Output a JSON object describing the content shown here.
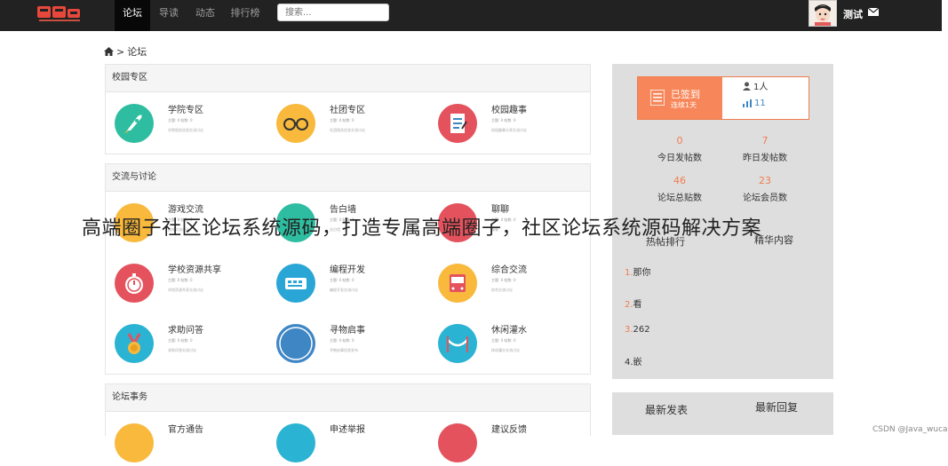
{
  "navbar": {
    "logo_icon": "site-logo-icon",
    "items": [
      {
        "label": "论坛",
        "active": true
      },
      {
        "label": "导读",
        "active": false
      },
      {
        "label": "动态",
        "active": false
      },
      {
        "label": "排行榜",
        "active": false
      }
    ],
    "search_placeholder": "搜索...",
    "username": "测试"
  },
  "breadcrumb": {
    "home_icon": "home-icon",
    "separator": ">",
    "current": "论坛"
  },
  "sections": [
    {
      "title": "校园专区",
      "forums": [
        {
          "name": "学院专区",
          "stats": "主题: 0  帖数: 0",
          "desc": "学院相关信息交流讨论",
          "color": "#2ebda0"
        },
        {
          "name": "社团专区",
          "stats": "主题: 0  帖数: 0",
          "desc": "社团相关信息交流讨论",
          "color": "#f8b93c"
        },
        {
          "name": "校园趣事",
          "stats": "主题: 0  帖数: 0",
          "desc": "校园趣事分享交流讨论",
          "color": "#e4525d"
        }
      ]
    },
    {
      "title": "交流与讨论",
      "forums": [
        {
          "name": "游戏交流",
          "stats": "主题: 0  帖数: 0",
          "desc": "游戏交流讨论",
          "color": "#f8b93c"
        },
        {
          "name": "告白墙",
          "stats": "主题: 0  帖数: 0",
          "desc": "告白墙",
          "color": "#2ebda0"
        },
        {
          "name": "聊聊",
          "stats": "主题: 0  帖数: 0",
          "desc": "聊聊",
          "color": "#e4525d"
        },
        {
          "name": "学校资源共享",
          "stats": "主题: 0  帖数: 0",
          "desc": "学校资源共享交流讨论",
          "color": "#e4525d"
        },
        {
          "name": "编程开发",
          "stats": "主题: 0  帖数: 0",
          "desc": "编程开发交流讨论",
          "color": "#2aa6d6"
        },
        {
          "name": "综合交流",
          "stats": "主题: 0  帖数: 0",
          "desc": "综合交流讨论",
          "color": "#f8b93c"
        },
        {
          "name": "求助问答",
          "stats": "主题: 0  帖数: 0",
          "desc": "求助问答交流讨论",
          "color": "#2ab3d2"
        },
        {
          "name": "寻物启事",
          "stats": "主题: 0  帖数: 0",
          "desc": "寻物启事信息发布",
          "color": "#3f86c5"
        },
        {
          "name": "休闲灌水",
          "stats": "主题: 0  帖数: 0",
          "desc": "休闲灌水交流讨论",
          "color": "#2ab3d2"
        }
      ]
    },
    {
      "title": "论坛事务",
      "forums": [
        {
          "name": "官方通告",
          "stats": "",
          "desc": "",
          "color": "#f8b93c"
        },
        {
          "name": "申述举报",
          "stats": "",
          "desc": "",
          "color": "#2ab3d2"
        },
        {
          "name": "建议反馈",
          "stats": "",
          "desc": "",
          "color": "#e4525d"
        }
      ]
    }
  ],
  "sidebar": {
    "sign_title": "已签到",
    "sign_sub": "连续1天",
    "online_count": "1人",
    "rank_value": "11",
    "stats": [
      {
        "num": "0",
        "label": "今日发帖数"
      },
      {
        "num": "7",
        "label": "昨日发帖数"
      },
      {
        "num": "46",
        "label": "论坛总贴数"
      },
      {
        "num": "23",
        "label": "论坛会员数"
      }
    ],
    "tabs": [
      "热帖排行",
      "精华内容"
    ],
    "hot_posts": [
      {
        "rank": "1.",
        "title": "那你"
      },
      {
        "rank": "2.",
        "title": "看"
      },
      {
        "rank": "3.",
        "title": "262"
      },
      {
        "rank": "4.",
        "title": "嵌"
      }
    ],
    "bottom_tabs": [
      "最新发表",
      "最新回复"
    ]
  },
  "overlay_title": "高端圈子社区论坛系统源码，打造专属高端圈子，社区论坛系统源码解决方案",
  "watermark": "CSDN @Java_wucao"
}
